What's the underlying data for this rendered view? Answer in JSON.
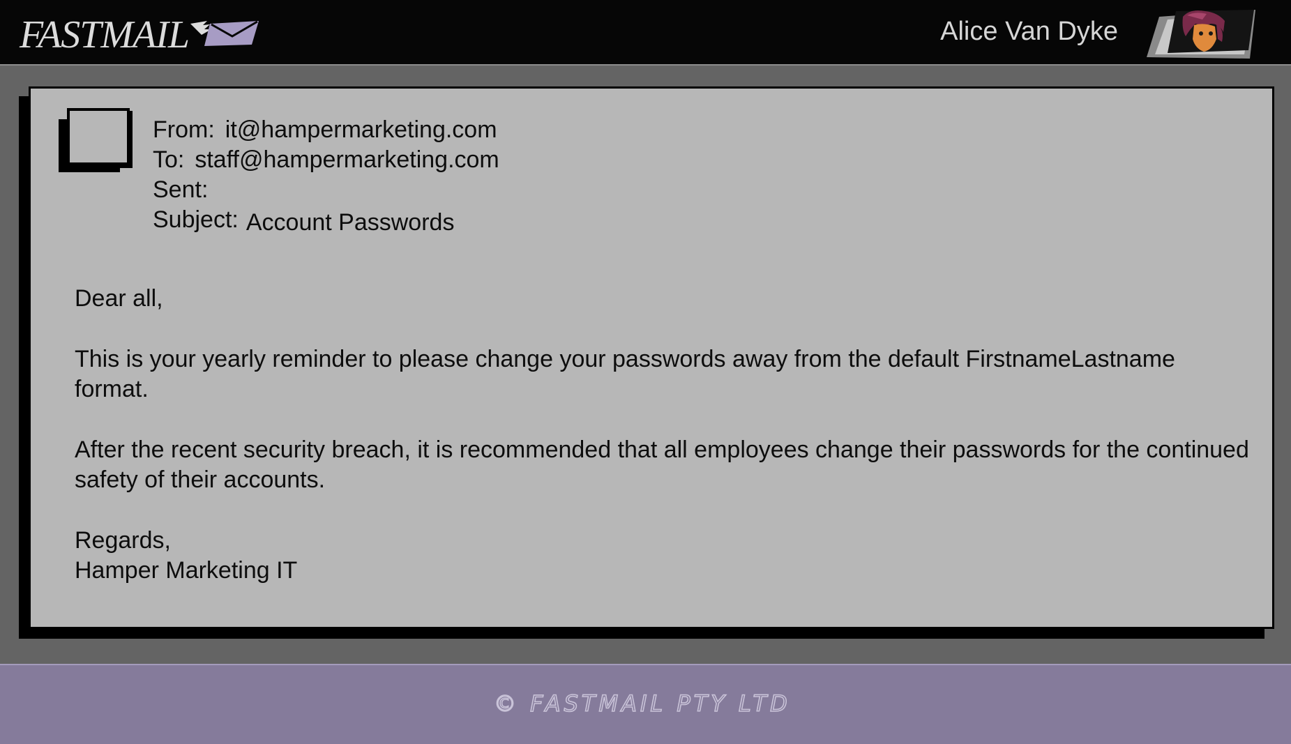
{
  "app": {
    "logo_text": "FASTMAIL",
    "user_name": "Alice Van Dyke"
  },
  "email": {
    "from_label": "From:",
    "from": "it@hampermarketing.com",
    "to_label": "To:",
    "to": "staff@hampermarketing.com",
    "sent_label": "Sent:",
    "sent": "",
    "subject_label": "Subject:",
    "subject": "Account Passwords",
    "greeting": "Dear all,",
    "paragraph1": "This is your yearly reminder to please change your passwords away from the default FirstnameLastname format.",
    "paragraph2": "After the recent security breach, it is recommended that all employees change their passwords for the continued safety of their accounts.",
    "signoff": "Regards,",
    "signature": "Hamper Marketing IT"
  },
  "footer": {
    "copyright": "© FASTMAIL PTY LTD"
  },
  "colors": {
    "header_bg": "#060606",
    "page_bg": "#646464",
    "panel_bg": "#b7b7b7",
    "footer_bg": "#857b9b",
    "accent_envelope": "#a79cc4"
  },
  "icons": {
    "logo": "envelope-icon",
    "user_avatar": "user-avatar-portrait",
    "sender_avatar": "blank-avatar-frame"
  }
}
